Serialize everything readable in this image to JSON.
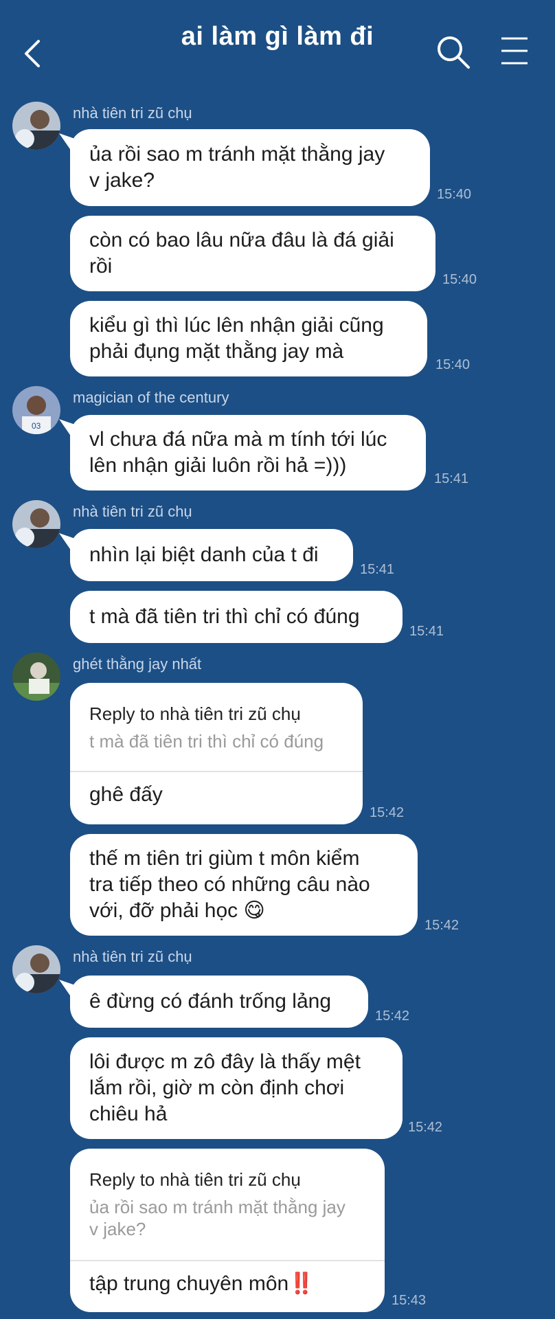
{
  "header": {
    "title": "ai làm gì làm đi",
    "back_icon": "chevron-left-icon",
    "search_icon": "search-icon",
    "menu_icon": "hamburger-menu-icon"
  },
  "senders": {
    "s1": "nhà tiên tri zũ chụ",
    "s2": "magician of the century",
    "s3": "ghét thằng jay nhất"
  },
  "messages": [
    {
      "line1": "ủa rồi sao m tránh mặt thằng jay",
      "line2": "v jake?",
      "time": "15:40"
    },
    {
      "line1": "còn có bao lâu nữa đâu là đá giải",
      "line2": "rồi",
      "time": "15:40"
    },
    {
      "line1": "kiểu gì thì lúc lên nhận giải cũng",
      "line2": "phải đụng mặt thằng jay mà",
      "time": "15:40"
    },
    {
      "line1": "vl chưa đá nữa mà m tính tới lúc",
      "line2": "lên nhận giải luôn rồi hả =)))",
      "time": "15:41"
    },
    {
      "line1": "nhìn lại biệt danh của t đi",
      "time": "15:41"
    },
    {
      "line1": "t mà đã tiên tri thì chỉ có đúng",
      "time": "15:41"
    },
    {
      "reply_label": "Reply to nhà tiên tri zũ chụ",
      "quoted1": "t mà đã tiên tri thì chỉ có đúng",
      "body": "ghê đấy",
      "time": "15:42"
    },
    {
      "line1": "thế m tiên tri giùm t môn kiểm",
      "line2": "tra tiếp theo có những câu nào",
      "line3": "với, đỡ phải học",
      "emoji": "😋",
      "time": "15:42"
    },
    {
      "line1": "ê đừng có đánh trống lảng",
      "time": "15:42"
    },
    {
      "line1": "lôi được m zô đây là thấy mệt",
      "line2": "lắm rồi, giờ m còn định chơi",
      "line3": "chiêu hả",
      "time": "15:42"
    },
    {
      "reply_label": "Reply to nhà tiên tri zũ chụ",
      "quoted1": "ủa rồi sao m tránh mặt thằng jay",
      "quoted2": "v jake?",
      "body": "tập trung chuyên môn",
      "emoji": "‼️",
      "time": "15:43"
    }
  ],
  "colors": {
    "background": "#1c4f85",
    "bubble": "#ffffff",
    "name_text": "#c9d7ea",
    "time_text": "#aebfd6"
  }
}
